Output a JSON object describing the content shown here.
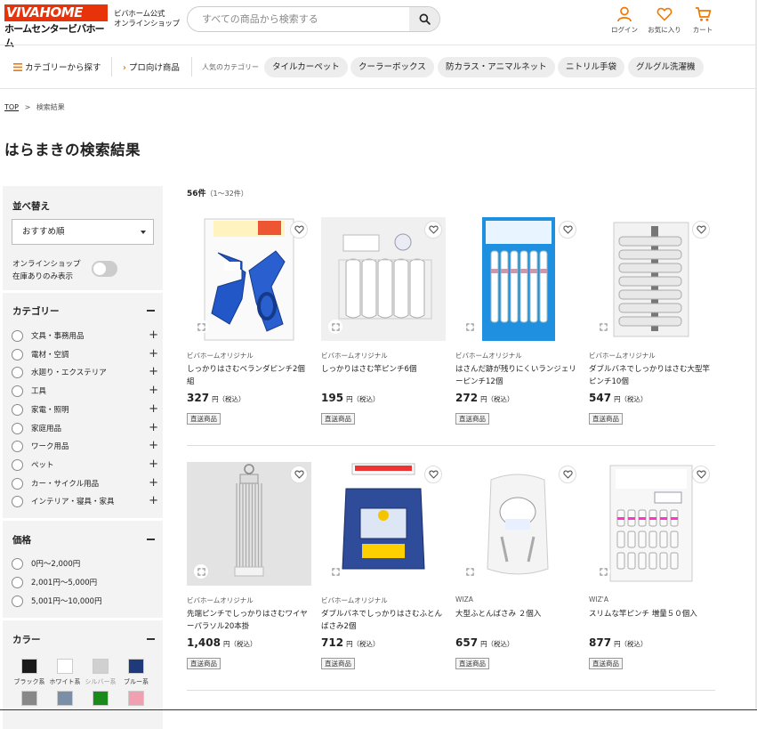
{
  "header": {
    "logo_top": "VIVAHOME",
    "logo_bottom": "ホームセンタービバホーム",
    "shop_label_1": "ビバホーム公式",
    "shop_label_2": "オンラインショップ",
    "search_placeholder": "すべての商品から検索する",
    "login_label": "ログイン",
    "favorites_label": "お気に入り",
    "cart_label": "カート",
    "accent_color": "#f07800"
  },
  "nav": {
    "category_link": "カテゴリーから探す",
    "pro_link": "プロ向け商品",
    "popular_label": "人気のカテゴリー",
    "chips": [
      "タイルカーペット",
      "クーラーボックス",
      "防カラス・アニマルネット",
      "ニトリル手袋",
      "グルグル洗濯機"
    ]
  },
  "breadcrumb": {
    "top": "TOP",
    "sep": ">",
    "current": "検索結果"
  },
  "page_title": "はらまきの検索結果",
  "sidebar": {
    "sort_heading": "並べ替え",
    "sort_value": "おすすめ順",
    "stock_line1": "オンラインショップ",
    "stock_line2": "在庫ありのみ表示",
    "category_heading": "カテゴリー",
    "categories": [
      "文具・事務用品",
      "電材・空調",
      "水廻り・エクステリア",
      "工具",
      "家電・照明",
      "家庭用品",
      "ワーク用品",
      "ペット",
      "カー・サイクル用品",
      "インテリア・寝具・家具"
    ],
    "price_heading": "価格",
    "prices": [
      "0円〜2,000円",
      "2,001円〜5,000円",
      "5,001円〜10,000円"
    ],
    "color_heading": "カラー",
    "colors": [
      {
        "label": "ブラック系",
        "hex": "#1a1a1a"
      },
      {
        "label": "ホワイト系",
        "hex": "#ffffff"
      },
      {
        "label": "シルバー系",
        "hex": "#d0d0d0"
      },
      {
        "label": "ブルー系",
        "hex": "#1f3a7a"
      },
      {
        "label": "",
        "hex": "#888888"
      },
      {
        "label": "",
        "hex": "#7a8ea8"
      },
      {
        "label": "",
        "hex": "#1a8a1a"
      },
      {
        "label": "",
        "hex": "#f0a0b0"
      }
    ]
  },
  "results": {
    "count": "56件",
    "range": "（1〜32件）",
    "products": [
      {
        "brand": "ビバホームオリジナル",
        "name": "しっかりはさむベランダピンチ2個組",
        "price": "327",
        "yen": "円（税込）",
        "tag": "直送商品",
        "icon": "blue-clothespins-pack"
      },
      {
        "brand": "ビバホームオリジナル",
        "name": "しっかりはさむ竿ピンチ6個",
        "price": "195",
        "yen": "円（税込）",
        "tag": "直送商品",
        "icon": "white-clothespins-pack"
      },
      {
        "brand": "ビバホームオリジナル",
        "name": "はさんだ跡が残りにくいランジェリーピンチ12個",
        "price": "272",
        "yen": "円（税込）",
        "tag": "直送商品",
        "icon": "lingerie-pins-pack"
      },
      {
        "brand": "ビバホームオリジナル",
        "name": "ダブルバネでしっかりはさむ大型竿ピンチ10個",
        "price": "547",
        "yen": "円（税込）",
        "tag": "直送商品",
        "icon": "large-pole-pins-pack"
      },
      {
        "brand": "ビバホームオリジナル",
        "name": "先端ピンチでしっかりはさむワイヤーパラソル20本掛",
        "price": "1,408",
        "yen": "円（税込）",
        "tag": "直送商品",
        "icon": "wire-parasol-hanger"
      },
      {
        "brand": "ビバホームオリジナル",
        "name": "ダブルバネでしっかりはさむふとんばさみ2個",
        "price": "712",
        "yen": "円（税込）",
        "tag": "直送商品",
        "icon": "futon-clip-pack"
      },
      {
        "brand": "WIZA",
        "name": "大型ふとんばさみ ２個入",
        "price": "657",
        "yen": "円（税込）",
        "tag": "直送商品",
        "icon": "white-futon-clip-pack"
      },
      {
        "brand": "WIZ'A",
        "name": "スリムな竿ピンチ 増量５０個入",
        "price": "877",
        "yen": "円（税込）",
        "tag": "直送商品",
        "icon": "slim-pins-bag"
      }
    ]
  }
}
